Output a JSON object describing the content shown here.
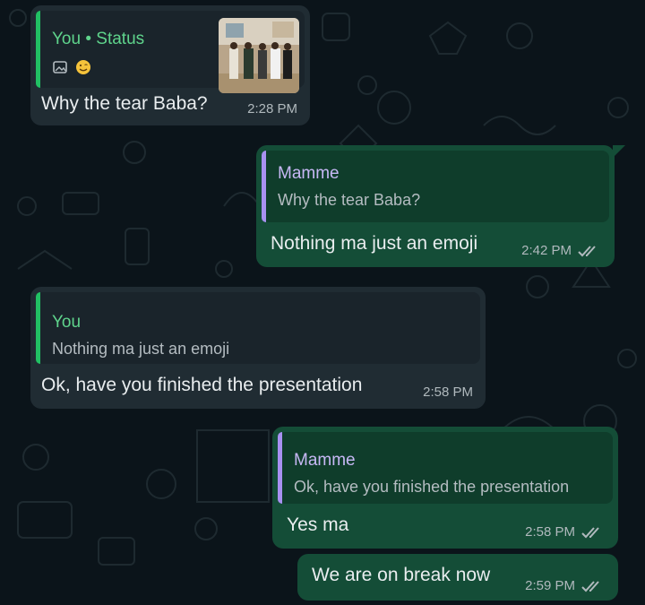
{
  "chat": {
    "messages": [
      {
        "direction": "in",
        "reply_to": {
          "author": "You",
          "context": "Status"
        },
        "text": "Why the tear Baba?",
        "time": "2:28 PM"
      },
      {
        "direction": "out",
        "reply_to": {
          "author": "Mamme",
          "text": "Why the tear Baba?"
        },
        "text": "Nothing ma just an emoji",
        "time": "2:42 PM",
        "status": "read"
      },
      {
        "direction": "in",
        "reply_to": {
          "author": "You",
          "text": "Nothing ma just an emoji"
        },
        "text": "Ok, have you finished the presentation",
        "time": "2:58 PM"
      },
      {
        "direction": "out",
        "reply_to": {
          "author": "Mamme",
          "text": "Ok, have you finished the presentation"
        },
        "text": "Yes ma",
        "time": "2:58 PM",
        "status": "read"
      },
      {
        "direction": "out",
        "text": "We are on break now",
        "time": "2:59 PM",
        "status": "read"
      }
    ]
  },
  "status_separator": "•",
  "icons": {
    "status_image": "image-icon",
    "status_emoji": "smiling-face-emoji-icon",
    "read_receipt": "double-check-icon"
  },
  "colors": {
    "background": "#0b141a",
    "incoming_bubble": "#202c33",
    "outgoing_bubble": "#144d37",
    "quote_bar_green": "#21c063",
    "quote_bar_purple": "#a891f1",
    "tick_color": "#b0b9bd"
  }
}
